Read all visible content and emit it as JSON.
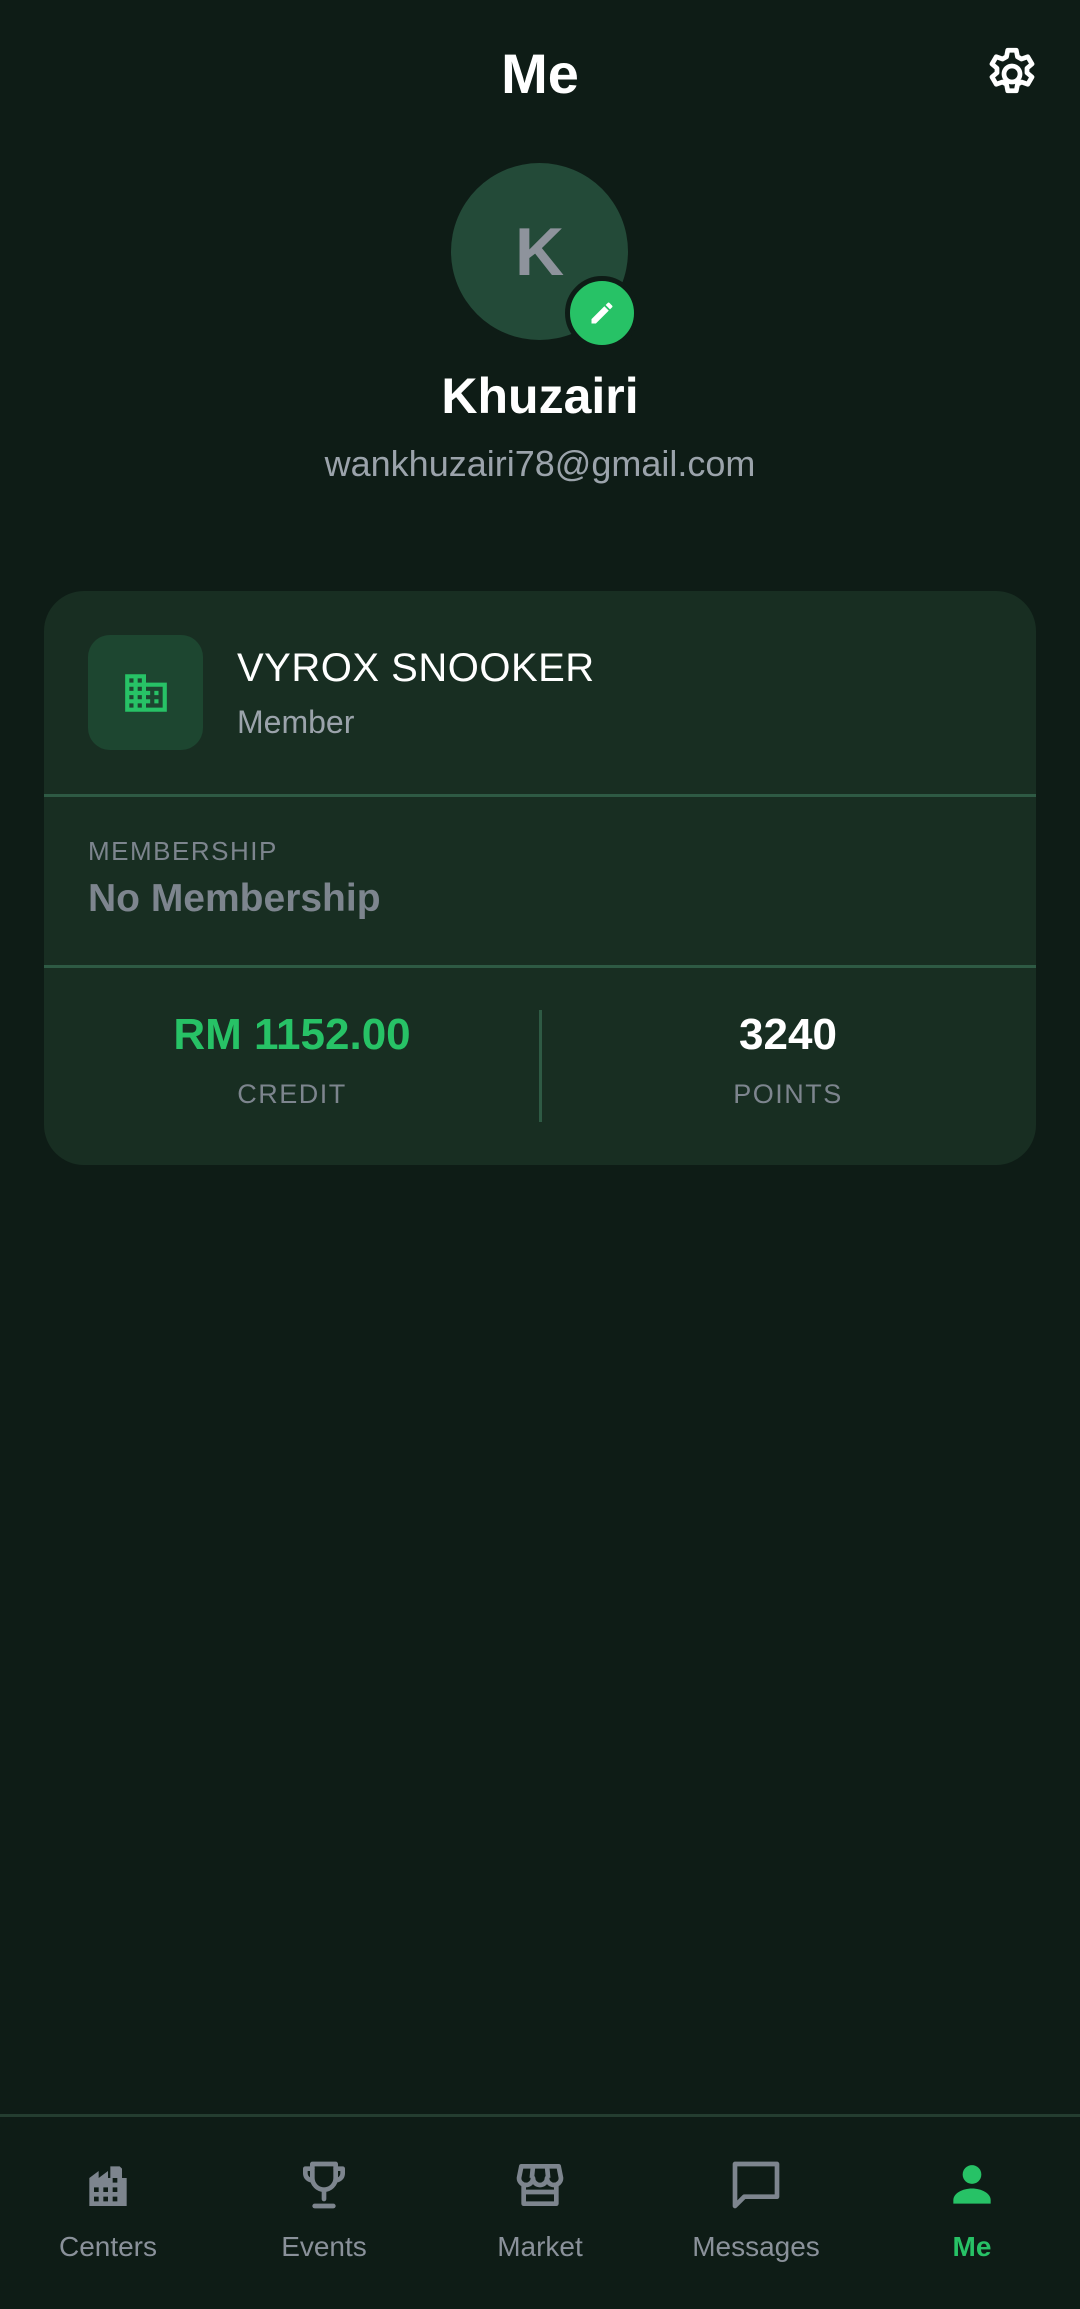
{
  "header": {
    "title": "Me",
    "settings_icon": "gear-icon"
  },
  "profile": {
    "avatar_initial": "K",
    "edit_icon": "pencil-icon",
    "name": "Khuzairi",
    "email": "wankhuzairi78@gmail.com"
  },
  "club": {
    "icon": "building-icon",
    "name": "VYROX SNOOKER",
    "role": "Member",
    "membership_label": "MEMBERSHIP",
    "membership_value": "No Membership",
    "credit_value": "RM 1152.00",
    "credit_label": "CREDIT",
    "points_value": "3240",
    "points_label": "POINTS"
  },
  "nav": {
    "items": [
      {
        "label": "Centers",
        "icon": "buildings-icon",
        "active": false
      },
      {
        "label": "Events",
        "icon": "trophy-icon",
        "active": false
      },
      {
        "label": "Market",
        "icon": "storefront-icon",
        "active": false
      },
      {
        "label": "Messages",
        "icon": "chat-bubble-icon",
        "active": false
      },
      {
        "label": "Me",
        "icon": "person-icon",
        "active": true
      }
    ]
  },
  "colors": {
    "background": "#0e1c16",
    "card": "#182e22",
    "accent": "#27c266",
    "muted_text": "#7d858e"
  }
}
